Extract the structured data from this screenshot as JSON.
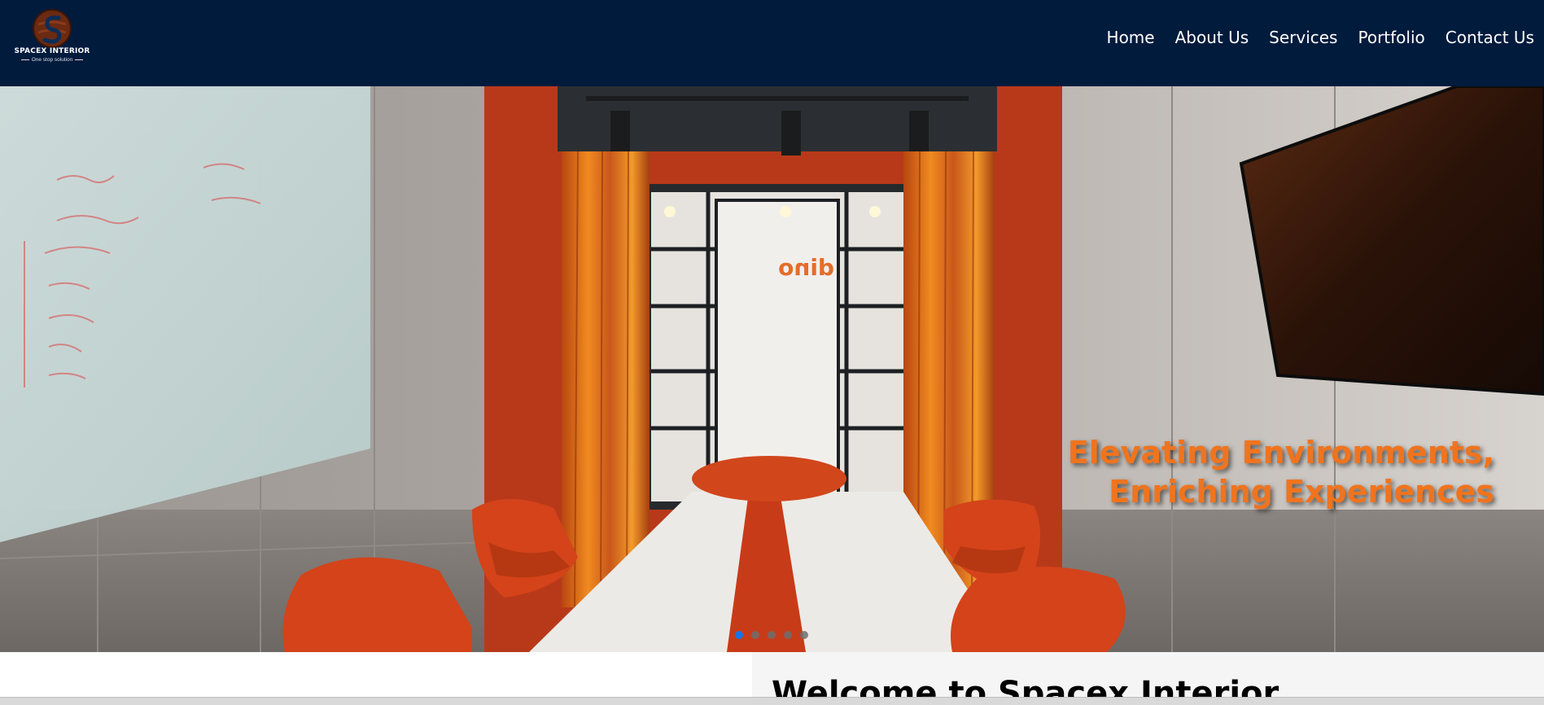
{
  "brand": {
    "name": "SPACEX INTERIOR",
    "tagline": "One stop solution"
  },
  "nav": {
    "items": [
      {
        "label": "Home"
      },
      {
        "label": "About Us"
      },
      {
        "label": "Services"
      },
      {
        "label": "Portfolio"
      },
      {
        "label": "Contact Us"
      }
    ]
  },
  "hero": {
    "headline_line1": "Elevating Environments,",
    "headline_line2": "Enriching Experiences",
    "slide_count": 5,
    "active_slide": 1,
    "image_description_icon": "meeting-room-photo"
  },
  "welcome": {
    "title": "Welcome to Spacex Interior"
  },
  "colors": {
    "navbar_bg": "#011b3d",
    "accent_orange": "#f0741e",
    "active_dot": "#1a73e8"
  }
}
